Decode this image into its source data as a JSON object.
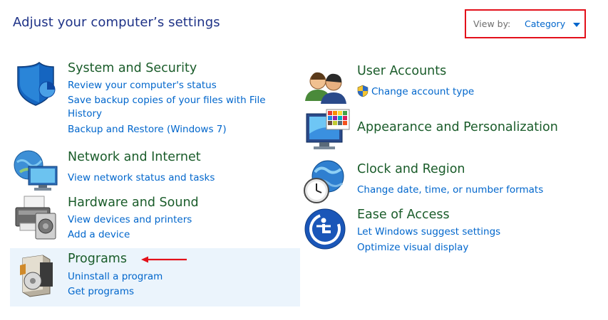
{
  "header": {
    "title": "Adjust your computer’s settings",
    "view_by_label": "View by:",
    "view_by_value": "Category"
  },
  "categories": [
    {
      "title": "System and Security",
      "links": [
        "Review your computer's status",
        "Save backup copies of your files with File",
        "History",
        "Backup and Restore (Windows 7)"
      ]
    },
    {
      "title": "Network and Internet",
      "links": [
        "View network status and tasks"
      ]
    },
    {
      "title": "Hardware and Sound",
      "links": [
        "View devices and printers",
        "Add a device"
      ]
    },
    {
      "title": "Programs",
      "links": [
        "Uninstall a program",
        "Get programs"
      ]
    },
    {
      "title": "User Accounts",
      "links": [
        "Change account type"
      ]
    },
    {
      "title": "Appearance and Personalization",
      "links": []
    },
    {
      "title": "Clock and Region",
      "links": [
        "Change date, time, or number formats"
      ]
    },
    {
      "title": "Ease of Access",
      "links": [
        "Let Windows suggest settings",
        "Optimize visual display"
      ]
    }
  ],
  "colors": {
    "title_text": "#1e3287",
    "category_title": "#1a5c2a",
    "link": "#0066cc",
    "highlight_box": "#e3101a",
    "hover_background": "#ebf4fc"
  },
  "icons": [
    "shield-icon",
    "network-icon",
    "printer-icon",
    "programs-icon",
    "users-icon",
    "monitor-icon",
    "clock-icon",
    "accessibility-icon",
    "uac-shield-icon",
    "red-arrow"
  ]
}
